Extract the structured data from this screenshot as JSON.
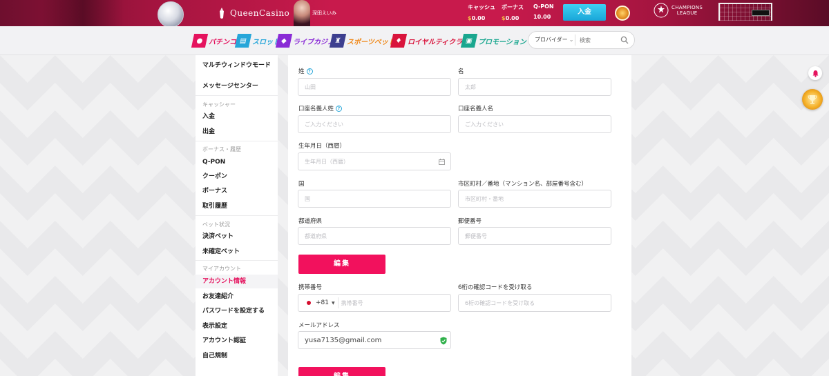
{
  "header": {
    "logo_text": "QueenCasino",
    "ambassador_name": "深田えいみ",
    "balances": [
      {
        "label": "キャッシュ",
        "currency": "$",
        "value": "0.00"
      },
      {
        "label": "ボーナス",
        "currency": "$",
        "value": "0.00"
      },
      {
        "label": "Q-PON",
        "currency": "",
        "value": "10.00"
      }
    ],
    "deposit_label": "入金",
    "league_text_1": "CHAMPIONS",
    "league_text_2": "LEAGUE"
  },
  "nav": {
    "items": [
      {
        "label": "パチンコ",
        "color": "#e5135e",
        "icon": "pachinko-icon"
      },
      {
        "label": "スロット",
        "color": "#27a6d9",
        "icon": "slot-icon"
      },
      {
        "label": "ライブカジノ",
        "color": "#8a2bd6",
        "icon": "live-casino-icon"
      },
      {
        "label": "スポーツベット",
        "color": "#f08a1c",
        "icon": "sports-icon"
      },
      {
        "label": "ロイヤルティクラブ",
        "color": "#d9143c",
        "icon": "loyalty-icon"
      },
      {
        "label": "プロモーション",
        "color": "#1aa78f",
        "icon": "promotion-icon"
      }
    ],
    "provider_label": "プロバイダー",
    "search_placeholder": "検索"
  },
  "sidebar": {
    "multi_window": "マルチウィンドウモード",
    "message_center": "メッセージセンター",
    "cashier_head": "キャッシャー",
    "deposit": "入金",
    "withdraw": "出金",
    "bonus_head": "ボーナス・履歴",
    "qpon": "Q-PON",
    "coupon": "クーポン",
    "bonus": "ボーナス",
    "transactions": "取引履歴",
    "bet_head": "ベット状況",
    "settled_bets": "決済ベット",
    "unsettled_bets": "未確定ベット",
    "account_head": "マイアカウント",
    "account_info": "アカウント情報",
    "refer_friend": "お友達紹介",
    "set_password": "パスワードを設定する",
    "display_settings": "表示設定",
    "account_verification": "アカウント認証",
    "self_exclusion": "自己規制"
  },
  "form": {
    "last_name_label": "姓",
    "last_name_placeholder": "山田",
    "first_name_label": "名",
    "first_name_placeholder": "太郎",
    "account_last_label": "口座名義人姓",
    "account_last_placeholder": "ご入力ください",
    "account_first_label": "口座名義人名",
    "account_first_placeholder": "ご入力ください",
    "birthdate_label": "生年月日（西暦）",
    "birthdate_placeholder": "生年月日（西暦）",
    "country_label": "国",
    "country_placeholder": "国",
    "city_label": "市区町村／番地（マンション名、部屋番号含む）",
    "city_placeholder": "市区町村・番地",
    "prefecture_label": "都道府県",
    "prefecture_placeholder": "都道府県",
    "postal_label": "郵便番号",
    "postal_placeholder": "郵便番号",
    "edit_label": "編集",
    "phone_label": "携帯番号",
    "phone_prefix": "+81",
    "phone_placeholder": "携帯番号",
    "code_label": "6桁の確認コードを受け取る",
    "code_placeholder": "6桁の確認コードを受け取る",
    "email_label": "メールアドレス",
    "email_value": "yusa7135@gmail.com",
    "edit_label_2": "編集"
  }
}
